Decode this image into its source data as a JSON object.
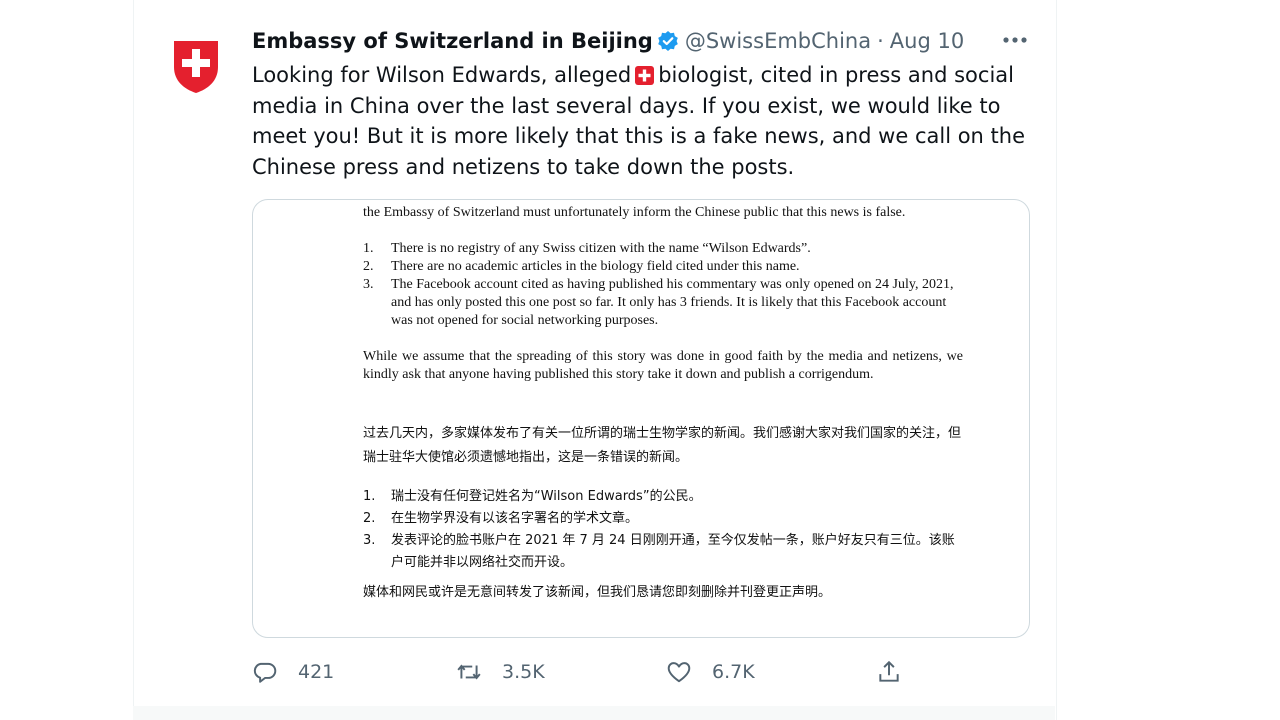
{
  "tweet": {
    "display_name": "Embassy of Switzerland in Beijing",
    "handle": "@SwissEmbChina",
    "separator": "·",
    "date": "Aug 10",
    "text_before_flag": "Looking for Wilson Edwards, alleged",
    "text_after_flag": "biologist, cited in press and social media in China over the last several days. If you exist, we would like to meet you! But it is more likely that this is a fake news, and we call on the Chinese press and netizens to take down the posts."
  },
  "media_document": {
    "intro": "the Embassy of Switzerland must unfortunately inform the Chinese public that this news is false.",
    "en_items": [
      {
        "num": "1.",
        "text": "There is no registry of any Swiss citizen with the name “Wilson Edwards”."
      },
      {
        "num": "2.",
        "text": "There are no academic articles in the biology field cited under this name."
      },
      {
        "num": "3.",
        "text": "The Facebook account cited as having published his commentary was only opened on 24 July, 2021, and has only posted this one post so far. It only has 3 friends. It is likely that this Facebook account was not opened for social networking purposes."
      }
    ],
    "en_paragraph": "While we assume that the spreading of this story was done in good faith by the media and netizens, we kindly ask that anyone having published this story take it down and publish a corrigendum.",
    "zh_paragraph": "过去几天内，多家媒体发布了有关一位所谓的瑞士生物学家的新闻。我们感谢大家对我们国家的关注，但瑞士驻华大使馆必须遗憾地指出，这是一条错误的新闻。",
    "zh_items": [
      {
        "num": "1.",
        "text": "瑞士没有任何登记姓名为“Wilson Edwards”的公民。"
      },
      {
        "num": "2.",
        "text": "在生物学界没有以该名字署名的学术文章。"
      },
      {
        "num": "3.",
        "text": "发表评论的脸书账户在 2021 年 7 月 24 日刚刚开通，至今仅发帖一条，账户好友只有三位。该账户可能并非以网络社交而开设。"
      }
    ],
    "zh_final": "媒体和网民或许是无意间转发了该新闻，但我们恳请您即刻删除并刊登更正声明。"
  },
  "actions": {
    "reply_count": "421",
    "retweet_count": "3.5K",
    "like_count": "6.7K"
  },
  "icons": {
    "avatar": "swiss-flag-shield",
    "verified": "verified-badge-icon",
    "more": "more-icon",
    "reply": "reply-icon",
    "retweet": "retweet-icon",
    "like": "heart-icon",
    "share": "share-icon"
  },
  "colors": {
    "swiss_red": "#e4202e",
    "verified_blue": "#1d9bf0",
    "secondary_text": "#536471"
  }
}
